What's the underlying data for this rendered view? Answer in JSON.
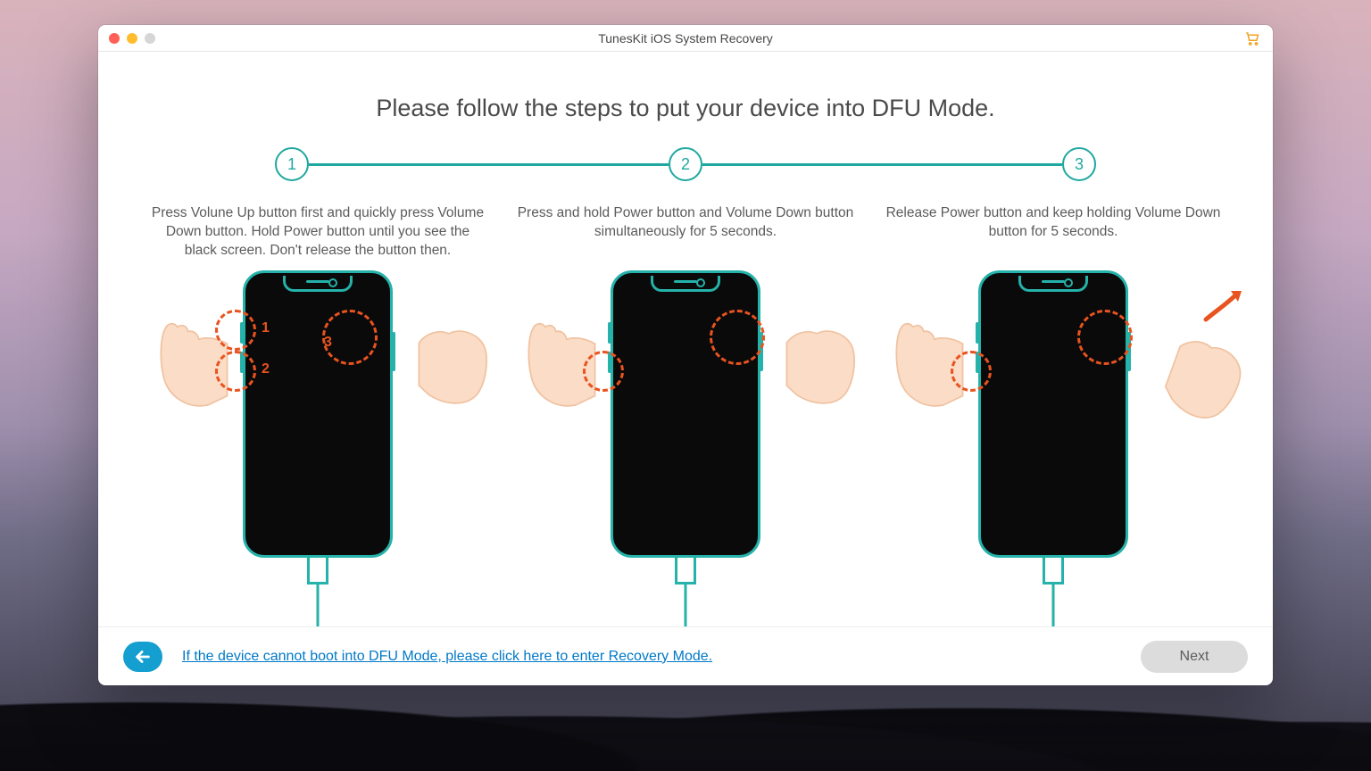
{
  "titlebar": {
    "title": "TunesKit iOS System Recovery"
  },
  "heading": "Please follow the steps to put your device into DFU Mode.",
  "steps": [
    {
      "num": "1",
      "desc": "Press Volune Up button first and quickly press Volume Down button. Hold Power button until you see the black screen. Don't release the button then."
    },
    {
      "num": "2",
      "desc": "Press and hold Power button and Volume Down button simultaneously for 5 seconds."
    },
    {
      "num": "3",
      "desc": "Release Power button and keep holding Volume Down button for 5 seconds."
    }
  ],
  "markers": {
    "one": "1",
    "two": "2",
    "three": "3"
  },
  "footer": {
    "link_text": "If the device cannot boot into DFU Mode, please click here to enter Recovery Mode.",
    "next_label": "Next"
  },
  "colors": {
    "accent": "#25b2aa",
    "orange": "#e8531f",
    "link": "#0079c7",
    "back": "#149fd0"
  }
}
